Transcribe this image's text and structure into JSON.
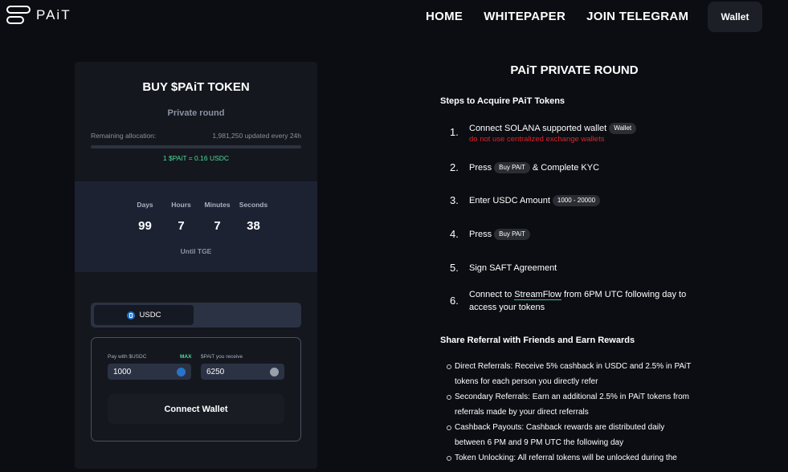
{
  "nav": {
    "logo_text": "PAiT",
    "links": [
      "HOME",
      "WHITEPAPER",
      "JOIN TELEGRAM"
    ],
    "wallet_label": "Wallet"
  },
  "buy_card": {
    "title": "BUY $PAiT TOKEN",
    "subtitle": "Private round",
    "remaining_label": "Remaining allocation:",
    "remaining_value": "1,981,250 updated every 24h",
    "allocation_progress": 1.0,
    "price": "1 $PAiT = 0.16 USDC",
    "timer": {
      "days_label": "Days",
      "hours_label": "Hours",
      "minutes_label": "Minutes",
      "seconds_label": "Seconds",
      "days": "99",
      "hours": "7",
      "minutes": "7",
      "seconds": "38",
      "caption": "Until TGE"
    },
    "token_tab": "USDC",
    "pay_label": "Pay with $USDC",
    "max_label": "MAX",
    "receive_label": "$PAiT you receive",
    "pay_value": "1000",
    "receive_value": "6250",
    "connect_label": "Connect Wallet"
  },
  "private_round": {
    "title": "PAiT PRIVATE ROUND",
    "steps_heading": "Steps to Acquire PAiT Tokens",
    "steps": {
      "s1": {
        "num": "1.",
        "text": "Connect SOLANA supported wallet",
        "chip": "Wallet",
        "warning": "do not use centralized exchange wallets"
      },
      "s2": {
        "num": "2.",
        "pre": "Press",
        "chip": "Buy PAiT",
        "post": "& Complete KYC"
      },
      "s3": {
        "num": "3.",
        "text": "Enter USDC Amount",
        "chip": "1000 - 20000"
      },
      "s4": {
        "num": "4.",
        "pre": "Press",
        "chip": "Buy PAiT"
      },
      "s5": {
        "num": "5.",
        "text": "Sign SAFT Agreement"
      },
      "s6": {
        "num": "6.",
        "pre": "Connect to",
        "link": "StreamFlow",
        "post": "from 6PM UTC following day to",
        "line2": "access your tokens"
      }
    },
    "share_heading": "Share Referral with Friends and Earn Rewards",
    "referrals": [
      {
        "line1": "Direct Referrals: Receive 5% cashback in USDC and 2.5% in PAiT",
        "line2": "tokens for each person you directly refer"
      },
      {
        "line1": "Secondary Referrals: Earn an additional 2.5% in PAiT tokens from",
        "line2": "referrals made by your direct referrals"
      },
      {
        "line1": "Cashback Payouts: Cashback rewards are distributed daily",
        "line2": "between 6 PM and 9 PM UTC the following day"
      },
      {
        "line1": "Token Unlocking: All referral tokens will be unlocked during the",
        "line2": ""
      }
    ]
  },
  "colors": {
    "background": "#0b0d12",
    "accent_green": "#4ddc9b",
    "warning_red": "#e5212a",
    "usdc_blue": "#2775ca"
  }
}
